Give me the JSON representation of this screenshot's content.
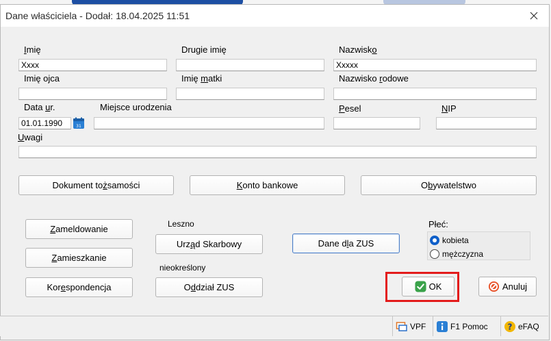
{
  "window": {
    "title": "Dane właściciela - Dodał:  18.04.2025 11:51"
  },
  "fields": {
    "imie": {
      "label": "Imię",
      "value": "Xxxx"
    },
    "drugie_imie": {
      "label": "Drugie imię",
      "value": ""
    },
    "nazwisko": {
      "label": "Nazwisko",
      "value": "Xxxxx"
    },
    "imie_ojca": {
      "label": "Imię ojca",
      "value": ""
    },
    "imie_matki": {
      "label": "Imię matki",
      "value": ""
    },
    "nazwisko_rodowe": {
      "label": "Nazwisko rodowe",
      "value": ""
    },
    "data_ur": {
      "label": "Data ur.",
      "value": "01.01.1990"
    },
    "miejsce_urodzenia": {
      "label": "Miejsce urodzenia",
      "value": ""
    },
    "pesel": {
      "label": "Pesel",
      "value": ""
    },
    "nip": {
      "label": "NIP",
      "value": ""
    },
    "uwagi": {
      "label": "Uwagi",
      "value": ""
    }
  },
  "buttons": {
    "dokument": "Dokument tożsamości",
    "konto": "Konto bankowe",
    "obywatelstwo": "Obywatelstwo",
    "zameldowanie": "Zameldowanie",
    "zamieszkanie": "Zamieszkanie",
    "korespondencja": "Korespondencja",
    "urzad": "Urząd Skarbowy",
    "oddzial": "Oddział ZUS",
    "dane_zus": "Dane dla ZUS",
    "ok": "OK",
    "anuluj": "Anuluj"
  },
  "info": {
    "urzad_value": "Leszno",
    "oddzial_value": "nieokreślony"
  },
  "plec": {
    "label": "Płeć:",
    "options": [
      "kobieta",
      "mężczyzna"
    ],
    "selected": "kobieta"
  },
  "statusbar": {
    "vpf": "VPF",
    "pomoc": "F1 Pomoc",
    "efaq": "eFAQ"
  },
  "colors": {
    "accent": "#0f5fc9",
    "highlight": "#e31b1b",
    "ok_icon": "#3aa24a",
    "cancel_icon": "#e8532b"
  },
  "icons": {
    "close": "close-icon",
    "calendar": "calendar-icon",
    "ok": "check-icon",
    "cancel": "cancel-icon",
    "vpf": "vpf-icon",
    "help": "info-icon",
    "faq": "question-icon"
  }
}
